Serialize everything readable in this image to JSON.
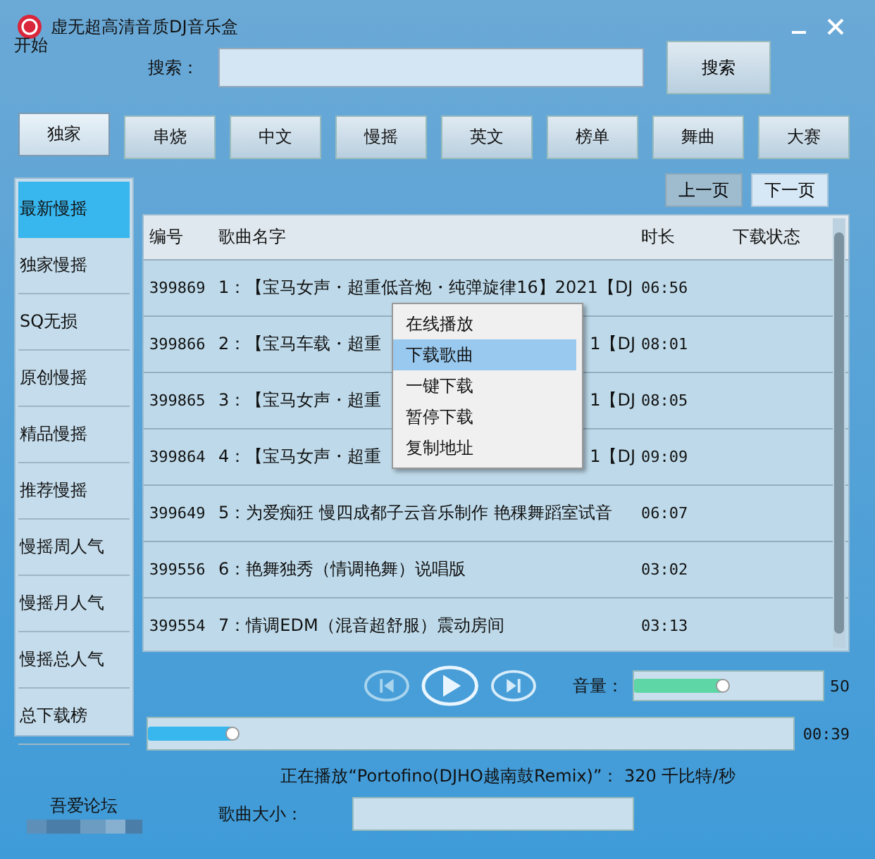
{
  "window": {
    "title": "虚无超高清音质DJ音乐盒",
    "start_label": "开始"
  },
  "search": {
    "label": "搜索：",
    "button": "搜索"
  },
  "tabs": [
    {
      "label": "独家",
      "selected": true
    },
    {
      "label": "串烧",
      "selected": false
    },
    {
      "label": "中文",
      "selected": false
    },
    {
      "label": "慢摇",
      "selected": false
    },
    {
      "label": "英文",
      "selected": false
    },
    {
      "label": "榜单",
      "selected": false
    },
    {
      "label": "舞曲",
      "selected": false
    },
    {
      "label": "大赛",
      "selected": false
    }
  ],
  "pager": [
    {
      "label": "上一页",
      "disabled": true
    },
    {
      "label": "下一页",
      "disabled": false
    }
  ],
  "sidebar": {
    "items": [
      {
        "label": "最新慢摇",
        "selected": true
      },
      {
        "label": "独家慢摇",
        "selected": false
      },
      {
        "label": "SQ无损",
        "selected": false
      },
      {
        "label": "原创慢摇",
        "selected": false
      },
      {
        "label": "精品慢摇",
        "selected": false
      },
      {
        "label": "推荐慢摇",
        "selected": false
      },
      {
        "label": "慢摇周人气",
        "selected": false
      },
      {
        "label": "慢摇月人气",
        "selected": false
      },
      {
        "label": "慢摇总人气",
        "selected": false
      },
      {
        "label": "总下载榜",
        "selected": false
      }
    ]
  },
  "table": {
    "columns": [
      "编号",
      "歌曲名字",
      "时长",
      "下载状态"
    ],
    "rows": [
      {
        "id": "399869",
        "title": "1：【宝马女声・超重低音炮・纯弹旋律16】2021【DJ",
        "duration": "06:56"
      },
      {
        "id": "399866",
        "title": "2：【宝马车载・超重",
        "title_tail": "1【DJ",
        "duration": "08:01"
      },
      {
        "id": "399865",
        "title": "3：【宝马女声・超重",
        "title_tail": "1【DJ",
        "duration": "08:05"
      },
      {
        "id": "399864",
        "title": "4：【宝马女声・超重",
        "title_tail": "1【DJ",
        "duration": "09:09"
      },
      {
        "id": "399649",
        "title": "5：为爱痴狂 慢四成都子云音乐制作 艳稞舞蹈室试音",
        "duration": "06:07"
      },
      {
        "id": "399556",
        "title": "6：艳舞独秀（情调艳舞）说唱版",
        "duration": "03:02"
      },
      {
        "id": "399554",
        "title": "7：情调EDM（混音超舒服）震动房间",
        "duration": "03:13"
      }
    ]
  },
  "context_menu": [
    {
      "label": "在线播放",
      "selected": false
    },
    {
      "label": "下载歌曲",
      "selected": true
    },
    {
      "label": "一键下载",
      "selected": false
    },
    {
      "label": "暂停下载",
      "selected": false
    },
    {
      "label": "复制地址",
      "selected": false
    }
  ],
  "player": {
    "volume_label": "音量：",
    "volume": {
      "level": 0.47
    },
    "volume_reading": "50",
    "progress": {
      "level": 0.13
    },
    "time": "00:39",
    "now_playing": "正在播放“Portofino(DJHO越南鼓Remix)”： 320 千比特/秒"
  },
  "footer": {
    "forum": "吾爱论坛",
    "size_label": "歌曲大小："
  }
}
